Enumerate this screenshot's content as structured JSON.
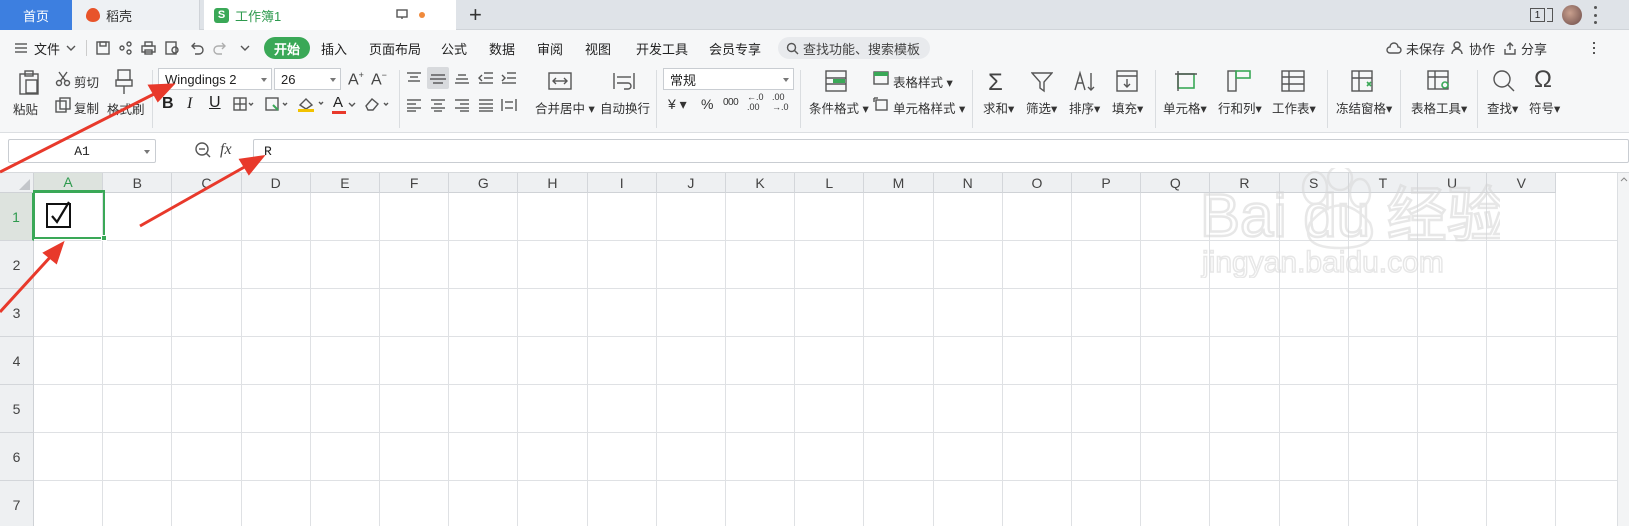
{
  "tabs": {
    "home": "首页",
    "daoke": "稻壳",
    "workbook": "工作簿1",
    "add": "+"
  },
  "window": {
    "counter": "1"
  },
  "menu": {
    "file": "文件",
    "items": [
      "开始",
      "插入",
      "页面布局",
      "公式",
      "数据",
      "审阅",
      "视图",
      "开发工具",
      "会员专享"
    ],
    "search_placeholder": "查找功能、搜索模板",
    "unsaved": "未保存",
    "collab": "协作",
    "share": "分享"
  },
  "ribbon": {
    "paste": "粘贴",
    "cut": "剪切",
    "copy": "复制",
    "format_painter": "格式刷",
    "font_name": "Wingdings 2",
    "font_size": "26",
    "merge_center": "合并居中",
    "wrap_text": "自动换行",
    "number_format": "常规",
    "conditional_format": "条件格式",
    "table_style": "表格样式",
    "cell_style": "单元格样式",
    "sum": "求和",
    "filter": "筛选",
    "sort": "排序",
    "fill": "填充",
    "cell": "单元格",
    "row_col": "行和列",
    "worksheet": "工作表",
    "freeze": "冻结窗格",
    "table_tools": "表格工具",
    "find": "查找",
    "symbol": "符号",
    "bold": "B",
    "italic": "I",
    "underline": "U",
    "font_color_letter": "A",
    "yuan": "¥",
    "percent": "%",
    "thousands": "000",
    "inc_decimal": "←.0 .00",
    "dec_decimal": ".00 →.0"
  },
  "formula_bar": {
    "cell_ref": "A1",
    "fx": "fx",
    "value": "R"
  },
  "sheet": {
    "columns": [
      "A",
      "B",
      "C",
      "D",
      "E",
      "F",
      "G",
      "H",
      "I",
      "J",
      "K",
      "L",
      "M",
      "N",
      "O",
      "P",
      "Q",
      "R",
      "S",
      "T",
      "U",
      "V"
    ],
    "rows": [
      "1",
      "2",
      "3",
      "4",
      "5",
      "6",
      "7"
    ],
    "a1_value": "☑"
  },
  "watermark": {
    "logo": "Baidu经验",
    "url": "jingyan.baidu.com"
  },
  "colors": {
    "accent_green": "#3aa857",
    "tab_blue": "#3d7fe0",
    "annotation_red": "#e8392b"
  }
}
